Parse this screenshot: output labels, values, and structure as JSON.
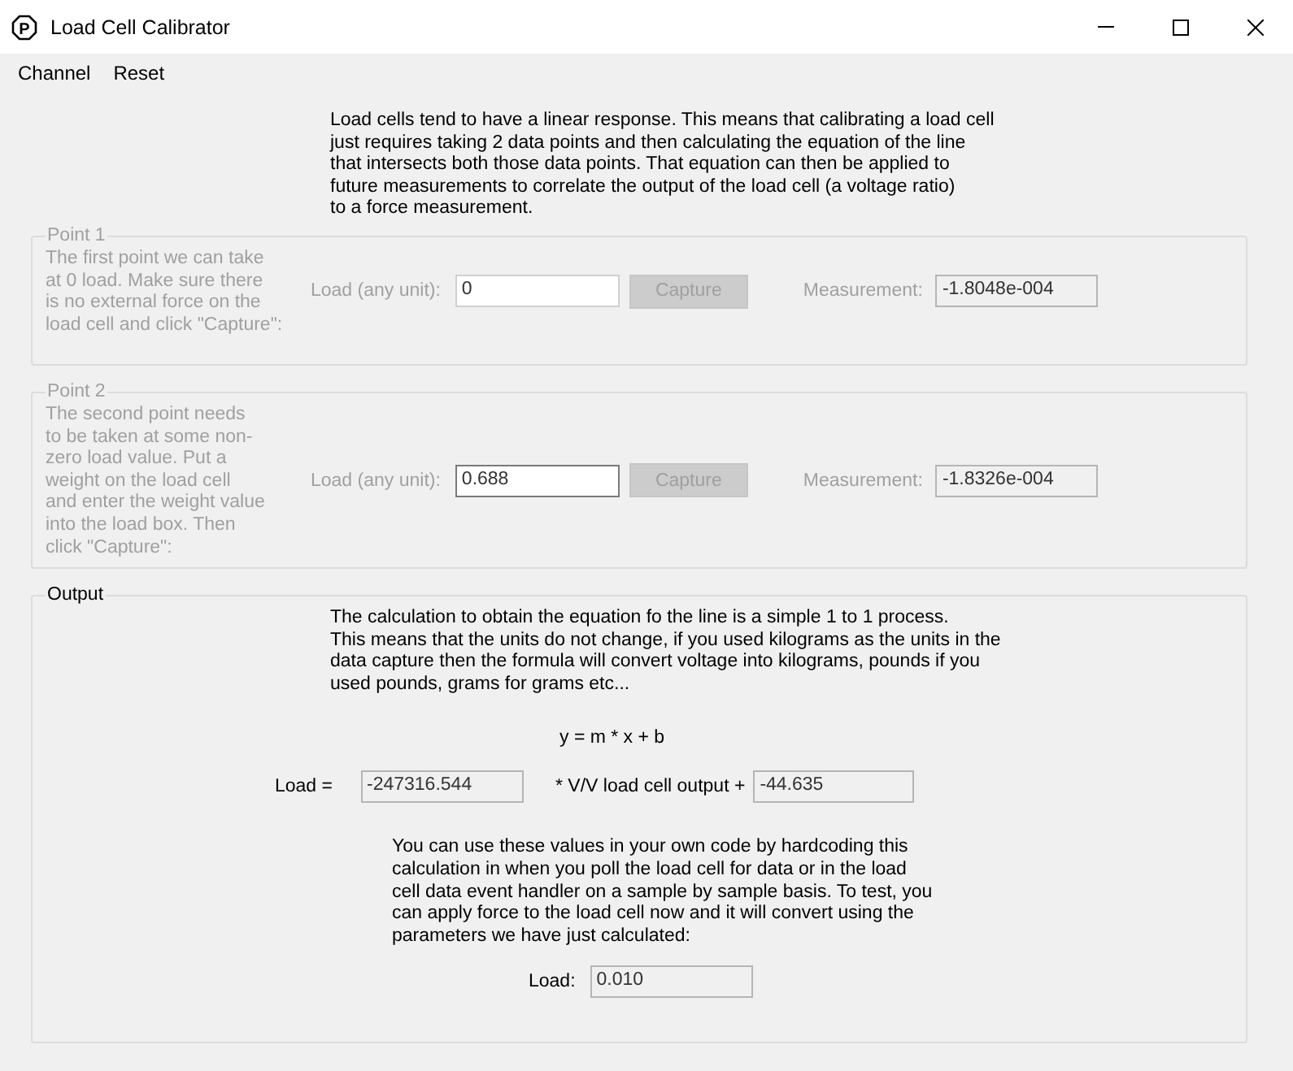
{
  "window": {
    "title": "Load Cell Calibrator",
    "icon_letter": "P"
  },
  "menu": [
    "Channel",
    "Reset"
  ],
  "intro": {
    "lines": [
      "Load cells tend to have a linear response.  This means that calibrating a load cell",
      "just requires taking 2 data points and then calculating the equation of the line",
      "that intersects both those data points.  That equation can then be applied to",
      "future measurements to correlate the output of the load cell (a voltage ratio)",
      "to a force measurement."
    ]
  },
  "points": [
    {
      "title": "Point 1",
      "disabled": true,
      "description_lines": [
        "The first point we can take",
        "at 0 load.  Make sure there",
        "is no external force on the",
        "load cell and click \"Capture\":"
      ],
      "load_label": "Load (any unit):",
      "load_value": "0",
      "load_focused": false,
      "capture": "Capture",
      "measurement_label": "Measurement:",
      "measurement_value": "-1.8048e-004"
    },
    {
      "title": "Point 2",
      "disabled": true,
      "description_lines": [
        "The second point needs",
        "to be taken at some non-",
        "zero load value.  Put a",
        "weight on the load cell",
        "and enter the weight value",
        "into the load box.  Then",
        "click \"Capture\":"
      ],
      "load_label": "Load (any unit):",
      "load_value": "0.688",
      "load_focused": true,
      "capture": "Capture",
      "measurement_label": "Measurement:",
      "measurement_value": "-1.8326e-004"
    }
  ],
  "output": {
    "title": "Output",
    "disabled": false,
    "explanation_lines": [
      "The calculation to obtain the equation fo the line is a simple 1 to 1 process.",
      "This means that the units do not change, if you used kilograms as the units in the",
      "data capture then the formula will convert voltage into kilograms, pounds if you",
      "used pounds, grams for grams etc..."
    ],
    "equation": "y = m * x + b",
    "load_label": "Load =",
    "slope": "-247316.544",
    "multiplier_label": "* V/V load cell output +",
    "intercept": "-44.635",
    "usage_lines": [
      "You can use these values in your own code by hardcoding this",
      "calculation in when you poll the load cell for data or in the load",
      "cell data event handler on a sample by sample basis.  To test, you",
      "can apply force to the load cell now and it will convert using the",
      "parameters we have just calculated:"
    ],
    "test_label": "Load:",
    "test_value": "0.010"
  }
}
